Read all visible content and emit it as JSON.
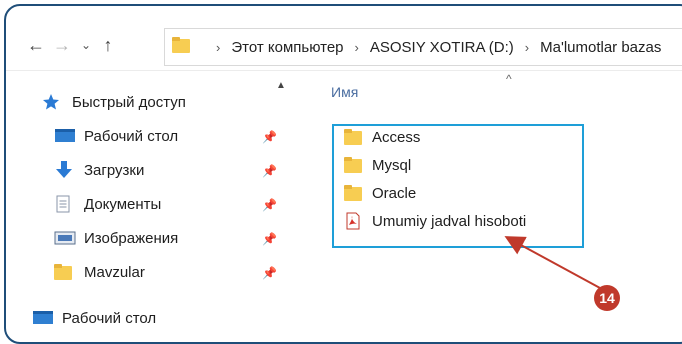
{
  "address_bar": {
    "back_icon": "arrow-left-icon",
    "forward_icon": "arrow-right-icon",
    "recent_icon": "chevron-down-icon",
    "up_icon": "arrow-up-icon",
    "crumbs": [
      "Этот компьютер",
      "ASOSIY XOTIRA (D:)",
      "Ma'lumotlar bazas"
    ],
    "separator": "›"
  },
  "navigation_pane": {
    "items": [
      {
        "label": "Быстрый доступ",
        "icon": "star-icon"
      },
      {
        "label": "Рабочий стол",
        "icon": "desktop-icon",
        "pinned": true
      },
      {
        "label": "Загрузки",
        "icon": "download-icon",
        "pinned": true
      },
      {
        "label": "Документы",
        "icon": "document-icon",
        "pinned": true
      },
      {
        "label": "Изображения",
        "icon": "pictures-icon",
        "pinned": true
      },
      {
        "label": "Mavzular",
        "icon": "folder-icon",
        "pinned": true
      },
      {
        "label": "Рабочий стол",
        "icon": "desktop-icon"
      }
    ]
  },
  "content": {
    "column_header": "Имя",
    "files": [
      {
        "name": "Access",
        "type": "folder"
      },
      {
        "name": "Mysql",
        "type": "folder"
      },
      {
        "name": "Oracle",
        "type": "folder"
      },
      {
        "name": "Umumiy jadval hisoboti",
        "type": "pdf"
      }
    ]
  },
  "annotation": {
    "number": "14",
    "color": "#c0392b",
    "highlight_color": "#1e9fd8"
  }
}
